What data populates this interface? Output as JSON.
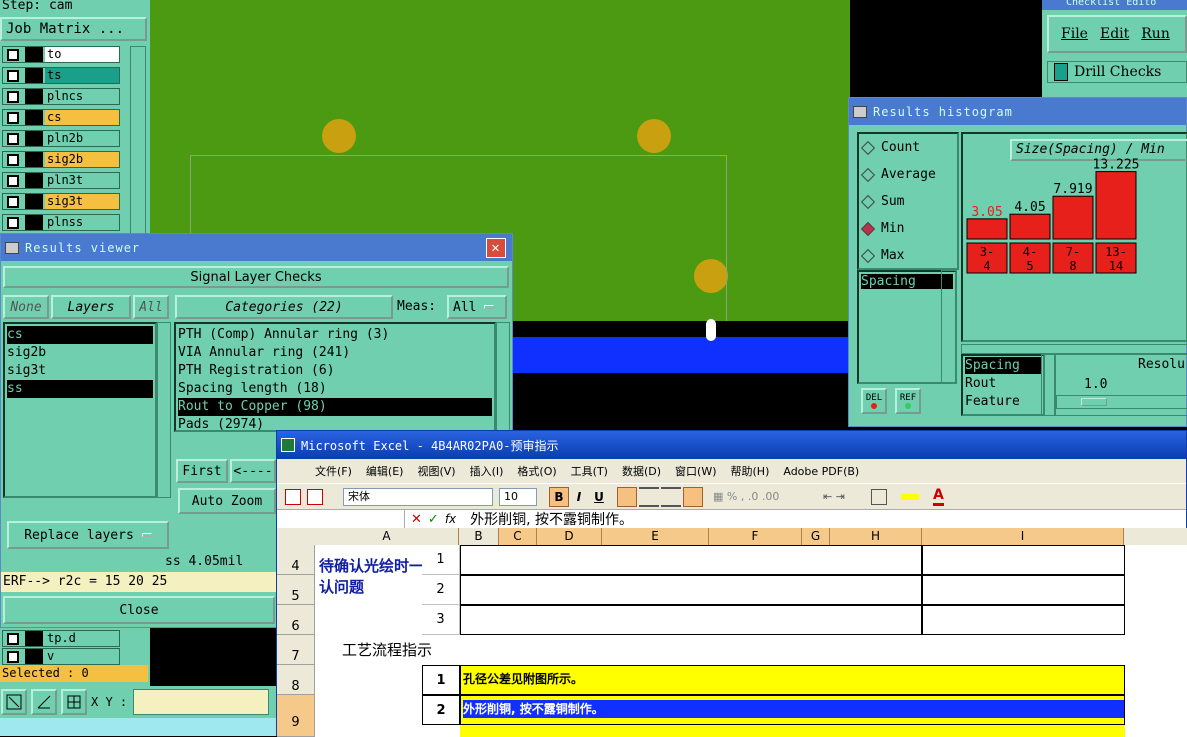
{
  "left_panel": {
    "step": "Step: cam",
    "job_matrix": "Job Matrix ...",
    "layers": [
      {
        "name": "to",
        "color": "#ffffff"
      },
      {
        "name": "ts",
        "color": "#1aa08a"
      },
      {
        "name": "plncs",
        "color": "#6fcfae"
      },
      {
        "name": "cs",
        "color": "#f5c040"
      },
      {
        "name": "pln2b",
        "color": "#6fcfae"
      },
      {
        "name": "sig2b",
        "color": "#f5c040"
      },
      {
        "name": "pln3t",
        "color": "#6fcfae"
      },
      {
        "name": "sig3t",
        "color": "#f5c040"
      },
      {
        "name": "plnss",
        "color": "#6fcfae"
      }
    ],
    "bottom_layers": [
      "tp.d",
      "v"
    ],
    "selected": "Selected : 0",
    "xy_label": "X Y :"
  },
  "results_viewer": {
    "title": "Results viewer",
    "header": "Signal Layer Checks",
    "none_btn": "None",
    "layers_btn": "Layers",
    "all_btn": "All",
    "categories_btn": "Categories (22)",
    "meas_label": "Meas:",
    "meas_value": "All",
    "layer_list": [
      "cs",
      "sig2b",
      "sig3t",
      "ss"
    ],
    "category_list": [
      "PTH (Comp) Annular ring (3)",
      "VIA Annular ring (241)",
      "PTH Registration (6)",
      "Spacing length (18)",
      "Rout to Copper (98)",
      "Pads (2974)"
    ],
    "first_btn": "First",
    "prev_btn": "<----",
    "auto_zoom": "Auto Zoom",
    "replace_layers": "Replace layers",
    "ss_value": "ss 4.05mil",
    "erf": "ERF--> r2c = 15 20 25",
    "close": "Close"
  },
  "histogram": {
    "title": "Results histogram",
    "options": [
      "Count",
      "Average",
      "Sum",
      "Min",
      "Max"
    ],
    "selected_option": "Min",
    "header": "Size(Spacing) / Min",
    "list_items": [
      "Spacing"
    ],
    "del_btn": "DEL",
    "ref_btn": "REF",
    "mode_items": [
      "Spacing",
      "Rout",
      "Feature"
    ],
    "resolution_label": "Resolu",
    "resolution_value": "1.0"
  },
  "chart_data": {
    "type": "bar",
    "title": "Size(Spacing) / Min",
    "categories": [
      "3-4",
      "4-5",
      "7-8",
      "13-14"
    ],
    "values": [
      3.05,
      4.05,
      7.919,
      13.225
    ],
    "value_labels": [
      "3.05",
      "4.05",
      "7.919",
      "13.225"
    ],
    "ylim": [
      0,
      14
    ]
  },
  "checklist": {
    "title": "Checklist Edito",
    "menu": [
      "File",
      "Edit",
      "Run"
    ],
    "item": "Drill Checks"
  },
  "excel": {
    "title": "Microsoft Excel - 4B4AR02PA0-预审指示",
    "menu": [
      "文件(F)",
      "编辑(E)",
      "视图(V)",
      "插入(I)",
      "格式(O)",
      "工具(T)",
      "数据(D)",
      "窗口(W)",
      "帮助(H)",
      "Adobe PDF(B)"
    ],
    "font": "宋体",
    "size": "10",
    "formula": "外形削铜, 按不露铜制作。",
    "columns": [
      "A",
      "B",
      "C",
      "D",
      "E",
      "F",
      "G",
      "H",
      "I"
    ],
    "rows": [
      "4",
      "5",
      "6",
      "7",
      "8",
      "9"
    ],
    "a_label": "待确认光绘时一起确认问题",
    "b_values": [
      "1",
      "2",
      "3"
    ],
    "process_label": "工艺流程指示",
    "step_nums": [
      "1",
      "2"
    ],
    "step_texts": [
      "孔径公差见附图所示。",
      "外形削铜, 按不露铜制作。"
    ]
  }
}
